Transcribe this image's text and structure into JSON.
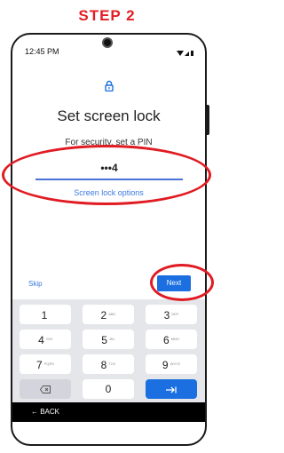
{
  "step_label": "STEP 2",
  "status_bar": {
    "time": "12:45 PM"
  },
  "screen": {
    "title": "Set screen lock",
    "subtitle": "For security, set a PIN",
    "pin_value": "•••4",
    "options_link": "Screen lock options",
    "skip_label": "Skip",
    "next_label": "Next"
  },
  "keyboard": {
    "keys": [
      {
        "label": "1",
        "sub": ""
      },
      {
        "label": "2",
        "sub": "ABC"
      },
      {
        "label": "3",
        "sub": "DEF"
      },
      {
        "label": "4",
        "sub": "GHI"
      },
      {
        "label": "5",
        "sub": "JKL"
      },
      {
        "label": "6",
        "sub": "MNO"
      },
      {
        "label": "7",
        "sub": "PQRS"
      },
      {
        "label": "8",
        "sub": "TUV"
      },
      {
        "label": "9",
        "sub": "WXYZ"
      },
      {
        "label": "0",
        "sub": ""
      }
    ]
  },
  "nav_bar": {
    "back_label": "← BACK"
  },
  "colors": {
    "highlight": "#e01b22",
    "accent": "#1b6fe0",
    "step": "#e31e24"
  }
}
